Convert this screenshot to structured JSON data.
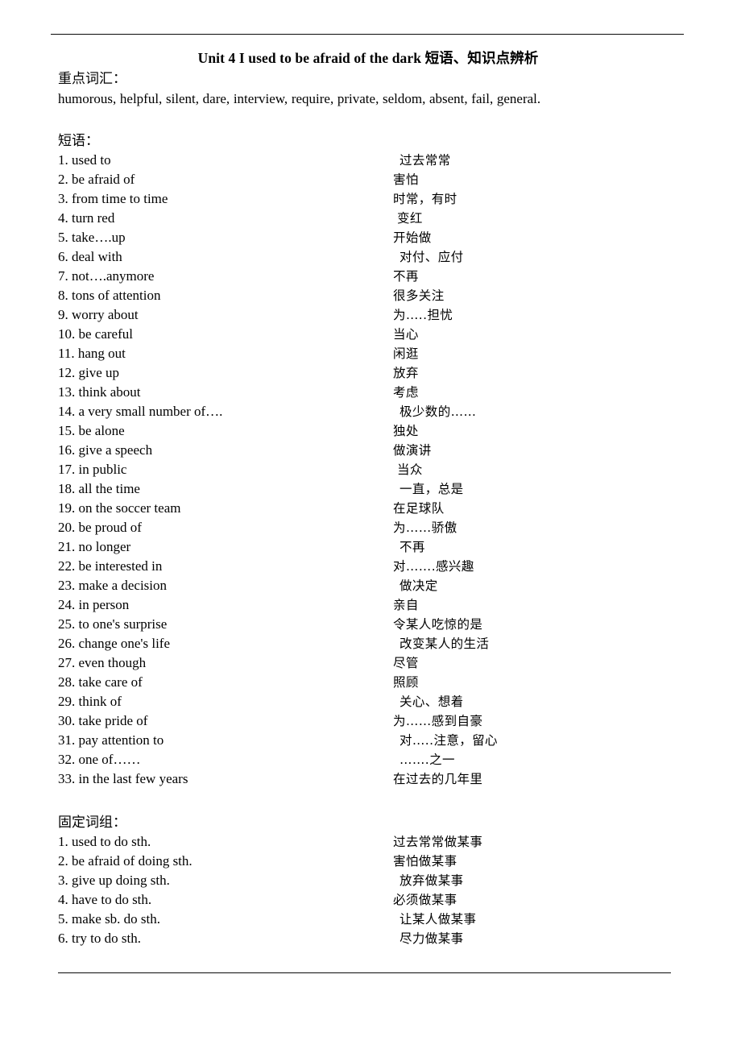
{
  "document": {
    "title": "Unit 4 I used to be afraid of the dark  短语、知识点辨析",
    "sections": {
      "vocab_heading": "重点词汇：",
      "vocab_text": "humorous, helpful, silent, dare, interview, require, private, seldom, absent, fail, general.",
      "phrases_heading": "短语：",
      "fixed_heading": "固定词组："
    }
  },
  "phrases": [
    {
      "num": "1.",
      "en": "used to",
      "cn": "过去常常",
      "indent": "i1"
    },
    {
      "num": "2.",
      "en": "be afraid of",
      "cn": "害怕",
      "indent": "i3"
    },
    {
      "num": "3.",
      "en": "from time to time",
      "cn": "时常，有时",
      "indent": "i3"
    },
    {
      "num": "4.",
      "en": "turn red",
      "cn": "变红",
      "indent": "i2"
    },
    {
      "num": "5.",
      "en": "take….up",
      "cn": "开始做",
      "indent": "i3"
    },
    {
      "num": "6.",
      "en": "deal with",
      "cn": "对付、应付",
      "indent": "i1"
    },
    {
      "num": "7.",
      "en": "not….anymore",
      "cn": "不再",
      "indent": "i3"
    },
    {
      "num": "8.",
      "en": "tons of attention",
      "cn": "很多关注",
      "indent": "i3"
    },
    {
      "num": "9.",
      "en": "worry about",
      "cn": "为…..担忧",
      "indent": "i3"
    },
    {
      "num": "10.",
      "en": "be careful",
      "cn": "当心",
      "indent": "i3"
    },
    {
      "num": "11.",
      "en": "hang out",
      "cn": "闲逛",
      "indent": "i3"
    },
    {
      "num": "12.",
      "en": "give up",
      "cn": "放弃",
      "indent": "i3"
    },
    {
      "num": "13.",
      "en": "think about",
      "cn": "考虑",
      "indent": "i3"
    },
    {
      "num": "14.",
      "en": "a very small number of….",
      "cn": "极少数的……",
      "indent": "i1"
    },
    {
      "num": "15.",
      "en": "be alone",
      "cn": "独处",
      "indent": "i3"
    },
    {
      "num": "16.",
      "en": "give a speech",
      "cn": "做演讲",
      "indent": "i3"
    },
    {
      "num": "17.",
      "en": "in public",
      "cn": "当众",
      "indent": "i2"
    },
    {
      "num": "18.",
      "en": "all the time",
      "cn": "一直，总是",
      "indent": "i1"
    },
    {
      "num": "19.",
      "en": "on the soccer team",
      "cn": "在足球队",
      "indent": "i3"
    },
    {
      "num": "20.",
      "en": "be proud of",
      "cn": "为……骄傲",
      "indent": "i3"
    },
    {
      "num": "21.",
      "en": "no longer",
      "cn": "不再",
      "indent": "i1"
    },
    {
      "num": "22.",
      "en": "be interested in",
      "cn": "对…….感兴趣",
      "indent": "i3"
    },
    {
      "num": "23.",
      "en": "make a decision",
      "cn": "做决定",
      "indent": "i1"
    },
    {
      "num": "24.",
      "en": "in person",
      "cn": "亲自",
      "indent": "i3"
    },
    {
      "num": "25.",
      "en": "to one's surprise",
      "cn": "令某人吃惊的是",
      "indent": "i3"
    },
    {
      "num": "26.",
      "en": "change one's life",
      "cn": "改变某人的生活",
      "indent": "i1"
    },
    {
      "num": "27.",
      "en": "even though",
      "cn": "尽管",
      "indent": "i3"
    },
    {
      "num": "28.",
      "en": "take care of",
      "cn": "照顾",
      "indent": "i3"
    },
    {
      "num": "29.",
      "en": "think of",
      "cn": "关心、想着",
      "indent": "i1"
    },
    {
      "num": "30.",
      "en": "take pride of",
      "cn": "为……感到自豪",
      "indent": "i3"
    },
    {
      "num": "31.",
      "en": "pay attention to",
      "cn": "对…..注意，留心",
      "indent": "i1"
    },
    {
      "num": "32.",
      "en": "one of……",
      "cn": "…….之一",
      "indent": "i1"
    },
    {
      "num": "33.",
      "en": "in the last few years",
      "cn": "在过去的几年里",
      "indent": "i3"
    }
  ],
  "fixed_phrases": [
    {
      "num": "1.",
      "en": "used to do sth.",
      "cn": "过去常常做某事",
      "indent": "i3"
    },
    {
      "num": "2.",
      "en": "be afraid of doing sth.",
      "cn": "害怕做某事",
      "indent": "i3"
    },
    {
      "num": "3.",
      "en": "give up doing sth.",
      "cn": "放弃做某事",
      "indent": "i1"
    },
    {
      "num": "4.",
      "en": "have to do sth.",
      "cn": "必须做某事",
      "indent": "i3"
    },
    {
      "num": "5.",
      "en": "make sb. do sth.",
      "cn": "让某人做某事",
      "indent": "i1"
    },
    {
      "num": "6.",
      "en": "try to do sth.",
      "cn": "尽力做某事",
      "indent": "i1"
    }
  ]
}
